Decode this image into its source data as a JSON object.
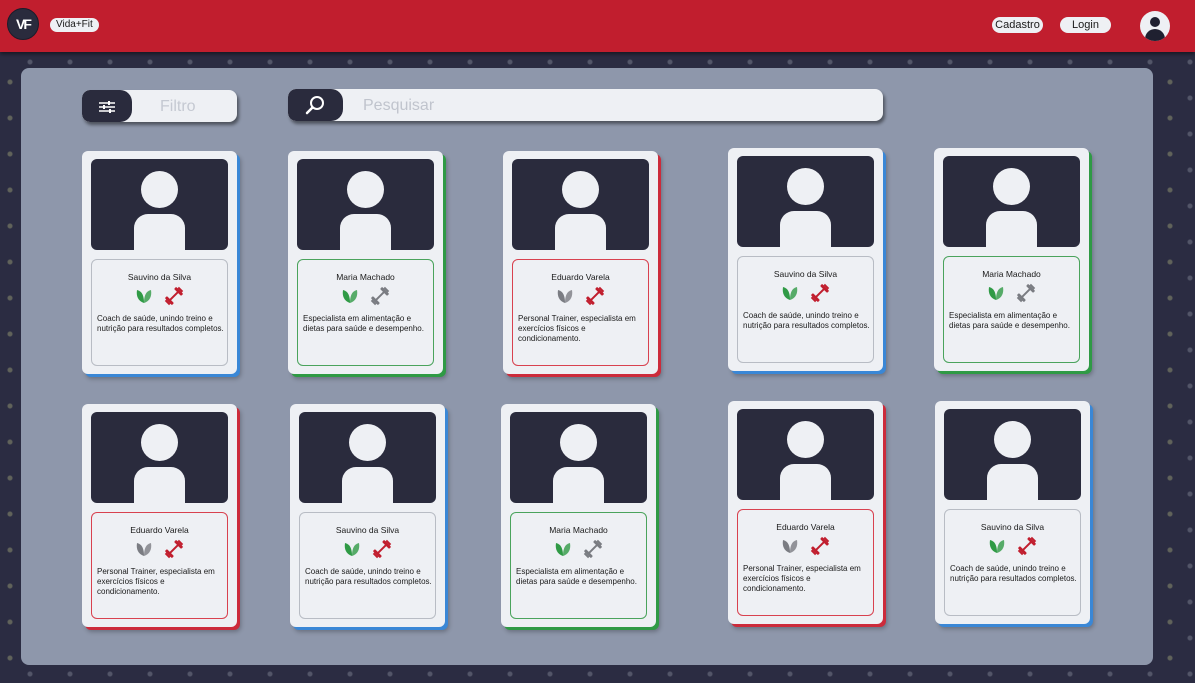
{
  "header": {
    "logo_text": "VF",
    "brand": "Vida+Fit",
    "cadastro_label": "Cadastro",
    "login_label": "Login",
    "user_icon": "user-avatar-icon"
  },
  "toolbar": {
    "filter_label": "Filtro",
    "filter_icon": "sliders-icon",
    "search_placeholder": "Pesquisar",
    "search_icon": "search-icon"
  },
  "colors": {
    "header": "#c11e2e",
    "panel": "#8e97ab",
    "dark": "#2a2b3d",
    "card": "#eef0f4",
    "blue_accent": "#3a87d6",
    "green_accent": "#2f9a45",
    "red_accent": "#cc2b3b",
    "leaf_active": "#2f9a45",
    "dumbbell_active": "#c11e2e",
    "icon_inactive": "#7a7c82"
  },
  "cards": [
    {
      "name": "Sauvino da Silva",
      "desc": "Coach de saúde, unindo treino e nutrição para resultados completos.",
      "accent": "blue",
      "leaf": true,
      "dumbbell": true
    },
    {
      "name": "Maria Machado",
      "desc": "Especialista em alimentação e dietas para saúde e desempenho.",
      "accent": "green",
      "leaf": true,
      "dumbbell": false
    },
    {
      "name": "Eduardo Varela",
      "desc": "Personal Trainer, especialista em exercícios físicos e condicionamento.",
      "accent": "red",
      "leaf": false,
      "dumbbell": true
    },
    {
      "name": "Sauvino da Silva",
      "desc": "Coach de saúde, unindo treino e nutrição para resultados completos.",
      "accent": "blue",
      "leaf": true,
      "dumbbell": true
    },
    {
      "name": "Maria Machado",
      "desc": "Especialista em alimentação e dietas para saúde e desempenho.",
      "accent": "green",
      "leaf": true,
      "dumbbell": false
    },
    {
      "name": "Eduardo Varela",
      "desc": "Personal Trainer, especialista em exercícios físicos e condicionamento.",
      "accent": "red",
      "leaf": false,
      "dumbbell": true
    },
    {
      "name": "Sauvino da Silva",
      "desc": "Coach de saúde, unindo treino e nutrição para resultados completos.",
      "accent": "blue",
      "leaf": true,
      "dumbbell": true
    },
    {
      "name": "Maria Machado",
      "desc": "Especialista em alimentação e dietas para saúde e desempenho.",
      "accent": "green",
      "leaf": true,
      "dumbbell": false
    },
    {
      "name": "Eduardo Varela",
      "desc": "Personal Trainer, especialista em exercícios físicos e condicionamento.",
      "accent": "red",
      "leaf": false,
      "dumbbell": true
    },
    {
      "name": "Sauvino da Silva",
      "desc": "Coach de saúde, unindo treino e nutrição para resultados completos.",
      "accent": "blue",
      "leaf": true,
      "dumbbell": true
    }
  ]
}
